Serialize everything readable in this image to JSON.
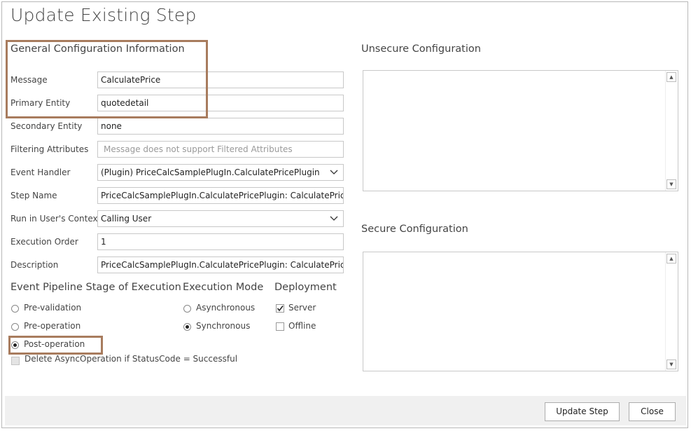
{
  "dialog": {
    "title": "Update Existing Step"
  },
  "general": {
    "section_title": "General Configuration Information",
    "message_label": "Message",
    "message_value": "CalculatePrice",
    "primary_entity_label": "Primary Entity",
    "primary_entity_value": "quotedetail",
    "secondary_entity_label": "Secondary Entity",
    "secondary_entity_value": "none",
    "filtering_label": "Filtering Attributes",
    "filtering_placeholder": "Message does not support Filtered Attributes",
    "event_handler_label": "Event Handler",
    "event_handler_value": "(Plugin) PriceCalcSamplePlugIn.CalculatePricePlugin",
    "step_name_label": "Step Name",
    "step_name_value": "PriceCalcSamplePlugIn.CalculatePricePlugin: CalculatePrice of quo",
    "run_context_label": "Run in User's Context",
    "run_context_value": "Calling User",
    "execution_order_label": "Execution Order",
    "execution_order_value": "1",
    "description_label": "Description",
    "description_value": "PriceCalcSamplePlugIn.CalculatePricePlugin: CalculatePrice of quo"
  },
  "pipeline": {
    "title": "Event Pipeline Stage of Execution",
    "options": [
      "Pre-validation",
      "Pre-operation",
      "Post-operation"
    ],
    "selected": "Post-operation"
  },
  "execution_mode": {
    "title": "Execution Mode",
    "options": [
      "Asynchronous",
      "Synchronous"
    ],
    "selected": "Synchronous"
  },
  "deployment": {
    "title": "Deployment",
    "server_label": "Server",
    "server_checked": true,
    "offline_label": "Offline",
    "offline_checked": false
  },
  "delete_async": {
    "label": "Delete AsyncOperation if StatusCode = Successful",
    "checked": false
  },
  "unsecure": {
    "title": "Unsecure  Configuration",
    "value": ""
  },
  "secure": {
    "title": "Secure  Configuration",
    "value": ""
  },
  "footer": {
    "update_button": "Update Step",
    "close_button": "Close"
  },
  "colors": {
    "highlight": "#a87c5e",
    "footer_bg": "#f0f0f0",
    "border": "#c8c8c8"
  },
  "icons": {
    "chevron": "chevron-down-icon",
    "scroll_up": "scroll-up-arrow-icon",
    "scroll_down": "scroll-down-arrow-icon",
    "checkmark": "checkmark-icon"
  }
}
